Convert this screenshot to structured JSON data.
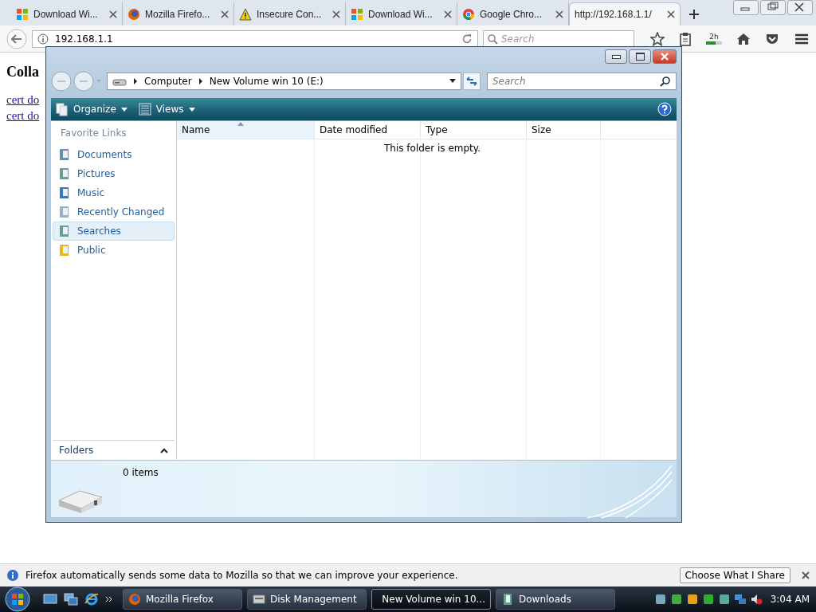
{
  "browser": {
    "tabs": [
      {
        "label": "Download Wi...",
        "kind": "windows",
        "selected": false
      },
      {
        "label": "Mozilla Firefo...",
        "kind": "firefox",
        "selected": false
      },
      {
        "label": "Insecure Con...",
        "kind": "warning",
        "selected": false
      },
      {
        "label": "Download Wi...",
        "kind": "windows",
        "selected": false
      },
      {
        "label": "Google Chro...",
        "kind": "chrome",
        "selected": false
      },
      {
        "label": "http://192.168.1.1/",
        "kind": "none",
        "selected": true
      }
    ],
    "address": "192.168.1.1",
    "search_placeholder": "Search",
    "badge": "2h"
  },
  "page": {
    "heading": "Colla",
    "links": [
      "cert do",
      "cert do"
    ]
  },
  "explorer": {
    "breadcrumb": [
      "Computer",
      "New Volume win 10 (E:)"
    ],
    "search_placeholder": "Search",
    "toolbar": [
      "Organize",
      "Views"
    ],
    "favorites_title": "Favorite Links",
    "favorites": [
      {
        "label": "Documents",
        "selected": false
      },
      {
        "label": "Pictures",
        "selected": false
      },
      {
        "label": "Music",
        "selected": false
      },
      {
        "label": "Recently Changed",
        "selected": false
      },
      {
        "label": "Searches",
        "selected": true
      },
      {
        "label": "Public",
        "selected": false
      }
    ],
    "folders_label": "Folders",
    "columns": [
      {
        "label": "Name",
        "sorted": true
      },
      {
        "label": "Date modified",
        "sorted": false
      },
      {
        "label": "Type",
        "sorted": false
      },
      {
        "label": "Size",
        "sorted": false
      }
    ],
    "empty_message": "This folder is empty.",
    "status": "0 items"
  },
  "notification": {
    "message": "Firefox automatically sends some data to Mozilla so that we can improve your experience.",
    "button": "Choose What I Share"
  },
  "taskbar": {
    "items": [
      {
        "label": "Mozilla Firefox",
        "selected": false
      },
      {
        "label": "Disk Management",
        "selected": false
      },
      {
        "label": "New Volume win 10...",
        "selected": true
      },
      {
        "label": "Downloads",
        "selected": false
      }
    ],
    "time": "3:04 AM"
  }
}
